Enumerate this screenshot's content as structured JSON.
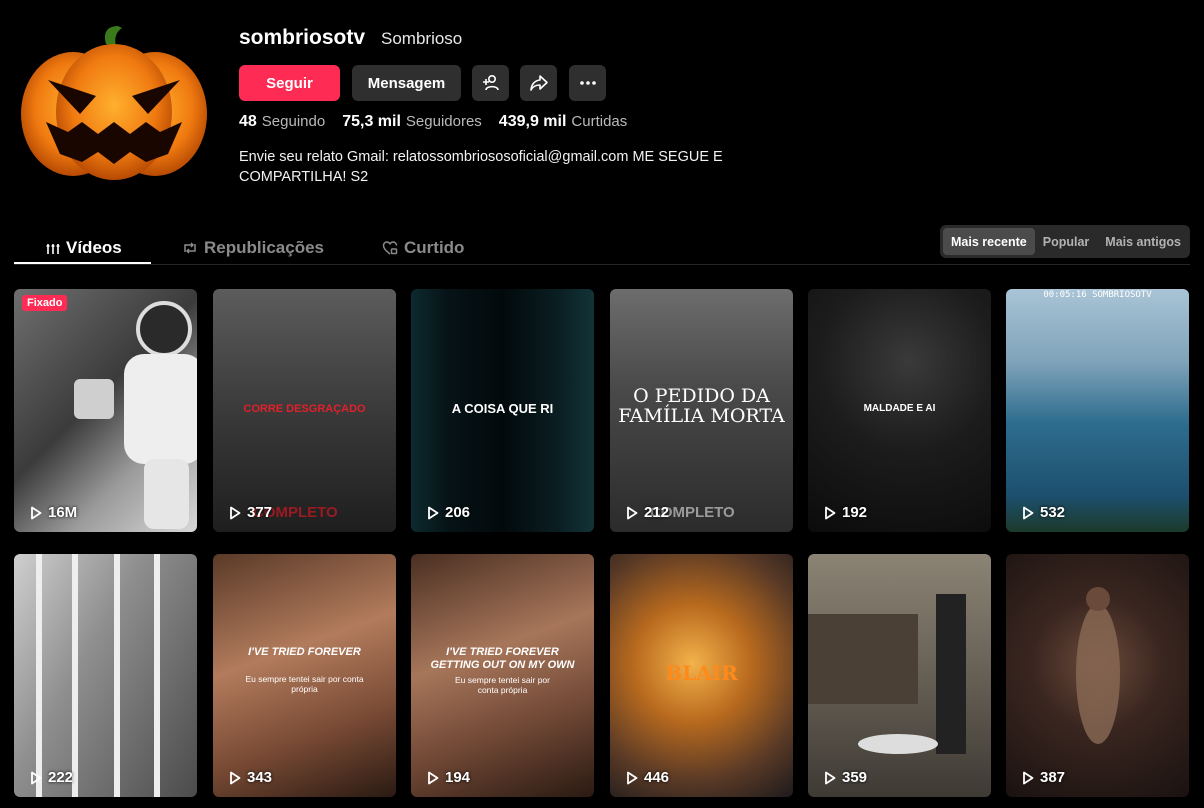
{
  "profile": {
    "username": "sombriosotv",
    "nickname": "Sombrioso",
    "follow_label": "Seguir",
    "message_label": "Mensagem",
    "following_count": "48",
    "following_label": "Seguindo",
    "followers_count": "75,3 mil",
    "followers_label": "Seguidores",
    "likes_count": "439,9 mil",
    "likes_label": "Curtidas",
    "bio_line1": "Envie seu relato Gmail: relatossombriososoficial@gmail.com ME SEGUE E",
    "bio_line2": "COMPARTILHA! S2"
  },
  "tabs": [
    {
      "label": "Vídeos"
    },
    {
      "label": "Republicações"
    },
    {
      "label": "Curtido"
    }
  ],
  "sort": [
    "Mais recente",
    "Popular",
    "Mais antigos"
  ],
  "videos": [
    {
      "views": "16M",
      "badge": "Fixado",
      "title": "",
      "bottom": ""
    },
    {
      "views": "377",
      "title": "CORRE DESGRAÇADO",
      "bottom": "COMPLETO"
    },
    {
      "views": "206",
      "title": "A COISA QUE RI",
      "bottom": ""
    },
    {
      "views": "212",
      "title": "O PEDIDO DA",
      "title2": "FAMÍLIA MORTA",
      "bottom": "COMPLETO"
    },
    {
      "views": "192",
      "title": "MALDADE E AI",
      "bottom": ""
    },
    {
      "views": "532",
      "title": "00:05:16 SOMBRIOSOTV",
      "bottom": ""
    },
    {
      "views": "222",
      "title": "",
      "bottom": ""
    },
    {
      "views": "343",
      "title": "I'VE TRIED FOREVER",
      "sub": "Eu sempre tentei sair por conta própria"
    },
    {
      "views": "194",
      "title": "I'VE TRIED FOREVER",
      "title2": "GETTING OUT ON MY OWN",
      "sub": "Eu sempre tentei sair por conta própria"
    },
    {
      "views": "446",
      "title": "BLAIR",
      "bottom": ""
    },
    {
      "views": "359",
      "title": "",
      "bottom": ""
    },
    {
      "views": "387",
      "title": "",
      "bottom": ""
    }
  ]
}
